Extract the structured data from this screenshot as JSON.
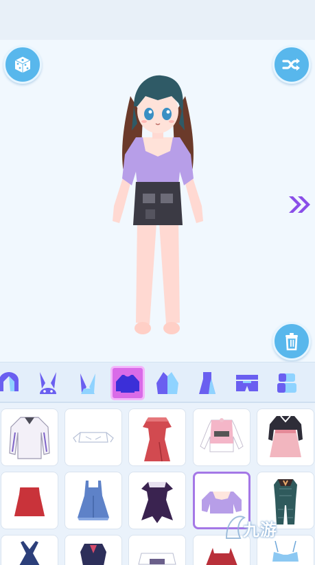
{
  "top_controls": {
    "dice_icon": "dice-icon",
    "shuffle_icon": "shuffle-icon",
    "next_icon": "double-chevron-right-icon",
    "trash_icon": "trash-icon"
  },
  "colors": {
    "accent_blue": "#58b7ec",
    "active_tab": "#d96be8",
    "selected_item_border": "#a477e6",
    "tab_icon": "#6a5ff0"
  },
  "categories": [
    {
      "name": "hair-category-icon"
    },
    {
      "name": "bunny-ears-category-icon"
    },
    {
      "name": "ears-category-icon"
    },
    {
      "name": "top-category-icon",
      "active": true
    },
    {
      "name": "jacket-category-icon"
    },
    {
      "name": "dress-category-icon"
    },
    {
      "name": "shorts-category-icon"
    },
    {
      "name": "skirt-category-icon"
    }
  ],
  "items": [
    {
      "name": "white-sweatshirt-item-icon"
    },
    {
      "name": "white-crop-top-item-icon"
    },
    {
      "name": "red-dress-item-icon"
    },
    {
      "name": "pink-sweater-item-icon"
    },
    {
      "name": "pink-pinafore-item-icon"
    },
    {
      "name": "red-santa-dress-item-icon"
    },
    {
      "name": "blue-denim-dress-item-icon"
    },
    {
      "name": "dark-gothic-dress-item-icon"
    },
    {
      "name": "lilac-blouse-item-icon",
      "selected": true
    },
    {
      "name": "plaid-jumpsuit-item-icon"
    }
  ],
  "watermark": {
    "text": "九游"
  }
}
